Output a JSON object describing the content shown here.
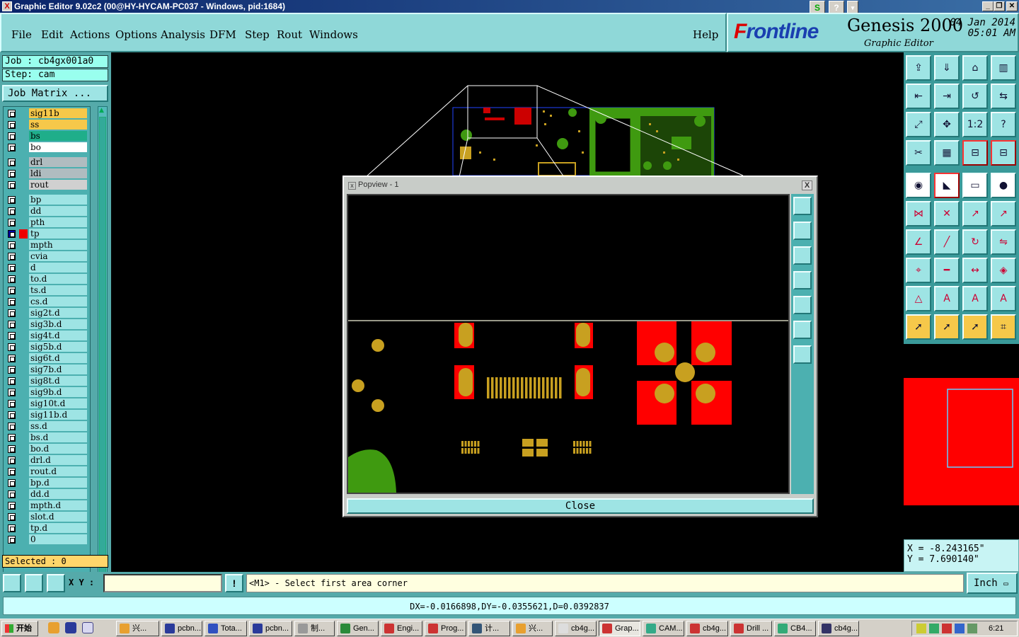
{
  "window": {
    "title": "Graphic Editor 9.02c2 (00@HY-HYCAM-PC037 - Windows, pid:1684)",
    "help_glyph": "?"
  },
  "menu": {
    "items": [
      "File",
      "Edit",
      "Actions",
      "Options",
      "Analysis",
      "DFM",
      "Step",
      "Rout",
      "Windows"
    ],
    "help": "Help"
  },
  "brand": {
    "logo_mark": "F",
    "logo_rest": "rontline",
    "product": "Genesis 2000",
    "subtitle": "Graphic Editor",
    "date": "04 Jan 2014",
    "time": "05:01 AM"
  },
  "job": {
    "job_label": "Job : cb4gx001a0",
    "step_label": "Step: cam",
    "matrix_button": "Job Matrix ...",
    "selected": "Selected : 0"
  },
  "layers": [
    {
      "name": "sig11b",
      "color": "#f6c84a"
    },
    {
      "name": "ss",
      "color": "#f6c84a"
    },
    {
      "name": "bs",
      "color": "#1fae8a"
    },
    {
      "name": "bo",
      "color": "#ffffff"
    },
    {
      "name": "drl",
      "color": "#b0bcc0"
    },
    {
      "name": "ldi",
      "color": "#b0bcc0"
    },
    {
      "name": "rout",
      "color": "#d0d0d0"
    },
    {
      "name": "bp",
      "color": "#9ee4e4"
    },
    {
      "name": "dd",
      "color": "#9ee4e4"
    },
    {
      "name": "pth",
      "color": "#9ee4e4"
    },
    {
      "name": "tp",
      "color": "#9ee4e4",
      "affected": true
    },
    {
      "name": "mpth",
      "color": "#9ee4e4"
    },
    {
      "name": "cvia",
      "color": "#9ee4e4"
    },
    {
      "name": "d",
      "color": "#9ee4e4"
    },
    {
      "name": "to.d",
      "color": "#9ee4e4"
    },
    {
      "name": "ts.d",
      "color": "#9ee4e4"
    },
    {
      "name": "cs.d",
      "color": "#9ee4e4"
    },
    {
      "name": "sig2t.d",
      "color": "#9ee4e4"
    },
    {
      "name": "sig3b.d",
      "color": "#9ee4e4"
    },
    {
      "name": "sig4t.d",
      "color": "#9ee4e4"
    },
    {
      "name": "sig5b.d",
      "color": "#9ee4e4"
    },
    {
      "name": "sig6t.d",
      "color": "#9ee4e4"
    },
    {
      "name": "sig7b.d",
      "color": "#9ee4e4"
    },
    {
      "name": "sig8t.d",
      "color": "#9ee4e4"
    },
    {
      "name": "sig9b.d",
      "color": "#9ee4e4"
    },
    {
      "name": "sig10t.d",
      "color": "#9ee4e4"
    },
    {
      "name": "sig11b.d",
      "color": "#9ee4e4"
    },
    {
      "name": "ss.d",
      "color": "#9ee4e4"
    },
    {
      "name": "bs.d",
      "color": "#9ee4e4"
    },
    {
      "name": "bo.d",
      "color": "#9ee4e4"
    },
    {
      "name": "drl.d",
      "color": "#9ee4e4"
    },
    {
      "name": "rout.d",
      "color": "#9ee4e4"
    },
    {
      "name": "bp.d",
      "color": "#9ee4e4"
    },
    {
      "name": "dd.d",
      "color": "#9ee4e4"
    },
    {
      "name": "mpth.d",
      "color": "#9ee4e4"
    },
    {
      "name": "slot.d",
      "color": "#9ee4e4"
    },
    {
      "name": "tp.d",
      "color": "#9ee4e4"
    },
    {
      "name": "0",
      "color": "#9ee4e4"
    }
  ],
  "popview": {
    "title": "Popview - 1",
    "close_x": "X",
    "close_button": "Close"
  },
  "right_tool_icons": [
    "open-step-icon",
    "save-icon",
    "home-icon",
    "window-split-icon",
    "undo-icon",
    "redo-icon",
    "zoom-back-icon",
    "swap-icon",
    "fit-icon",
    "center-icon",
    "scale-1-2-icon",
    "help-icon",
    "snap-icon",
    "grid-icon",
    "layer-tool-icon",
    "layer-tool2-icon",
    "pad-icon",
    "line-icon",
    "ruler-icon",
    "circle-icon",
    "connect-icon",
    "cross-icon",
    "move-icon",
    "copy-icon",
    "angle-icon",
    "line-draw-icon",
    "rotate-icon",
    "mirror-icon",
    "select-icon",
    "dash-icon",
    "measure-icon",
    "shapes-icon",
    "polygon-icon",
    "polygon2-icon",
    "polygon3-icon",
    "polygon4-icon",
    "pointer-icon",
    "pointer-box-icon",
    "pointer-dash-icon",
    "net-icon"
  ],
  "coords": {
    "x": "X = -8.243165\"",
    "y": "Y = 7.690140\""
  },
  "command": {
    "xy_label": "X Y :",
    "xy_value": "",
    "prompt": "<M1> - Select first area corner",
    "units": "Inch",
    "measure": "DX=-0.0166898,DY=-0.0355621,D=0.0392837"
  },
  "taskbar": {
    "start": "开始",
    "tasks": [
      "兴...",
      "pcbn...",
      "Tota...",
      "pcbn...",
      "制...",
      "Gen...",
      "Engi...",
      "Prog...",
      "计...",
      "兴...",
      "cb4g...",
      "Grap...",
      "CAM...",
      "cb4g...",
      "Drill ...",
      "CB4...",
      "cb4g..."
    ],
    "active_index": 11,
    "clock": "6:21"
  },
  "colors": {
    "pad_red": "#ff0000",
    "pad_yellow": "#c8a020",
    "copper_green": "#3f9a10",
    "panel_cyan": "#9ee4e4"
  }
}
